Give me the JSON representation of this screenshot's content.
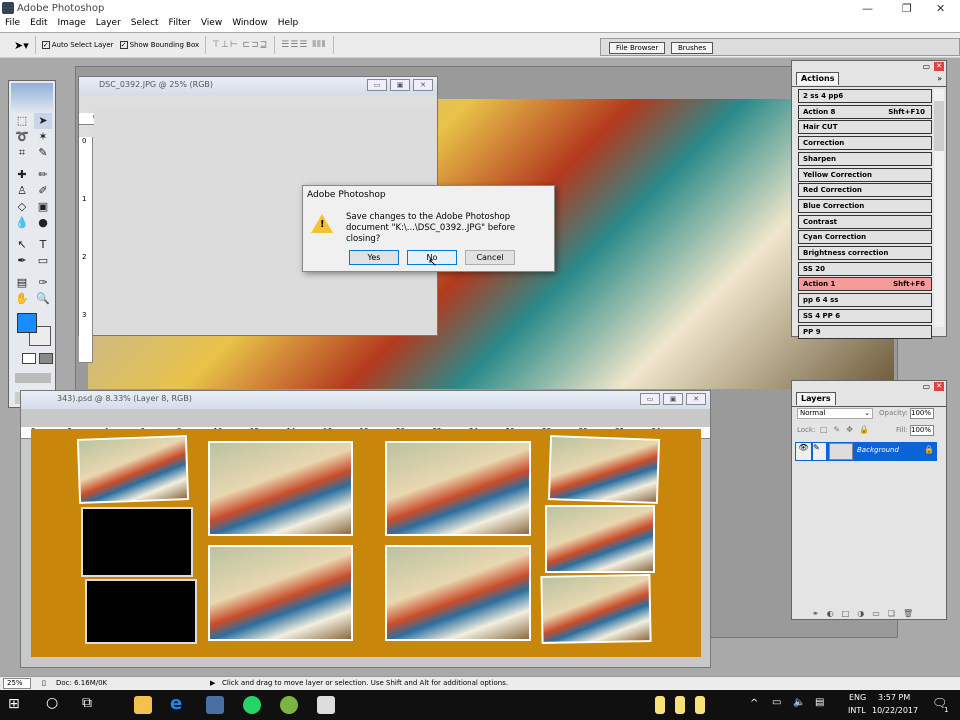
{
  "app": {
    "title": "Adobe Photoshop"
  },
  "menu": [
    "File",
    "Edit",
    "Image",
    "Layer",
    "Select",
    "Filter",
    "View",
    "Window",
    "Help"
  ],
  "options": {
    "auto_select_layer": "Auto Select Layer",
    "show_bounding_box": "Show Bounding Box",
    "auto_checked": true,
    "bbox_checked": true
  },
  "well_tabs": [
    "File Browser",
    "Brushes"
  ],
  "doc1": {
    "title": "DSC_0392.JPG @ 25% (RGB)",
    "ruler_h": [
      "0",
      "1",
      "2"
    ],
    "ruler_v": [
      "0",
      "1",
      "2",
      "3"
    ]
  },
  "doc2": {
    "title": "343).psd @ 8.33% (Layer 8, RGB)",
    "ruler": [
      "0",
      "2",
      "4",
      "6",
      "8",
      "10",
      "12",
      "14",
      "16",
      "18",
      "20",
      "22",
      "24",
      "26",
      "28",
      "30",
      "32",
      "34"
    ]
  },
  "dialog": {
    "title": "Adobe Photoshop",
    "message": "Save changes to the Adobe Photoshop document \"K:\\...\\DSC_0392..JPG\" before closing?",
    "yes": "Yes",
    "no": "No",
    "cancel": "Cancel"
  },
  "actions": {
    "tab": "Actions",
    "items": [
      {
        "name": "2 ss 4 pp6",
        "shortcut": ""
      },
      {
        "name": "Action 8",
        "shortcut": "Shft+F10"
      },
      {
        "name": "Hair CUT",
        "shortcut": ""
      },
      {
        "name": "Correction",
        "shortcut": ""
      },
      {
        "name": "Sharpen",
        "shortcut": ""
      },
      {
        "name": "Yellow Correction",
        "shortcut": ""
      },
      {
        "name": "Red Correction",
        "shortcut": ""
      },
      {
        "name": "Blue Correction",
        "shortcut": ""
      },
      {
        "name": "Contrast",
        "shortcut": ""
      },
      {
        "name": "Cyan Correction",
        "shortcut": ""
      },
      {
        "name": "Brightness correction",
        "shortcut": ""
      },
      {
        "name": "SS 20",
        "shortcut": ""
      },
      {
        "name": "Action 1",
        "shortcut": "Shft+F6",
        "highlight": "#f79a9a"
      },
      {
        "name": "pp 6 4 ss",
        "shortcut": ""
      },
      {
        "name": "SS 4 PP 6",
        "shortcut": ""
      },
      {
        "name": "PP 9",
        "shortcut": ""
      }
    ]
  },
  "layers": {
    "tab": "Layers",
    "blend": "Normal",
    "opacity_label": "Opacity:",
    "opacity": "100%",
    "lock_label": "Lock:",
    "fill_label": "Fill:",
    "fill": "100%",
    "layer": "Background",
    "selected_color": "#0a64d8"
  },
  "status": {
    "zoom": "25%",
    "doc": "Doc: 6.16M/0K",
    "hint": "Click and drag to move layer or selection. Use Shift and Alt for additional options."
  },
  "taskbar": {
    "lang1": "ENG",
    "lang2": "INTL",
    "time": "3:57 PM",
    "date": "10/22/2017",
    "notif": "1"
  },
  "colors": {
    "foreground": "#1a8cff",
    "canvas": "#c8860a"
  }
}
